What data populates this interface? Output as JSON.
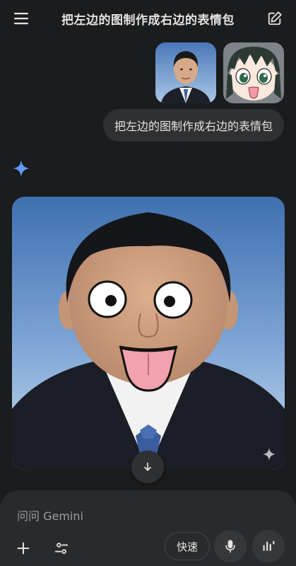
{
  "header": {
    "menu_icon": "hamburger-menu-icon",
    "title": "把左边的图制作成右边的表情包",
    "new_chat_icon": "edit-square-icon"
  },
  "user_message": {
    "attachments": [
      "portrait-photo",
      "anime-face-sticker"
    ],
    "text": "把左边的图制作成右边的表情包"
  },
  "response": {
    "avatar_icon": "gemini-sparkle-icon",
    "image": "generated-meme-image",
    "watermark_icon": "sparkle-watermark-icon"
  },
  "scroll_down_icon": "arrow-down-icon",
  "composer": {
    "placeholder": "问问 Gemini",
    "add_icon": "plus-icon",
    "tools_icon": "tools-sliders-icon",
    "mode_label": "快速",
    "mic_icon": "microphone-icon",
    "live_icon": "live-waveform-icon"
  },
  "colors": {
    "background": "#1b1c1d",
    "bubble": "#2f3032",
    "composer": "#282a2c",
    "accent": "#4c8df6"
  }
}
